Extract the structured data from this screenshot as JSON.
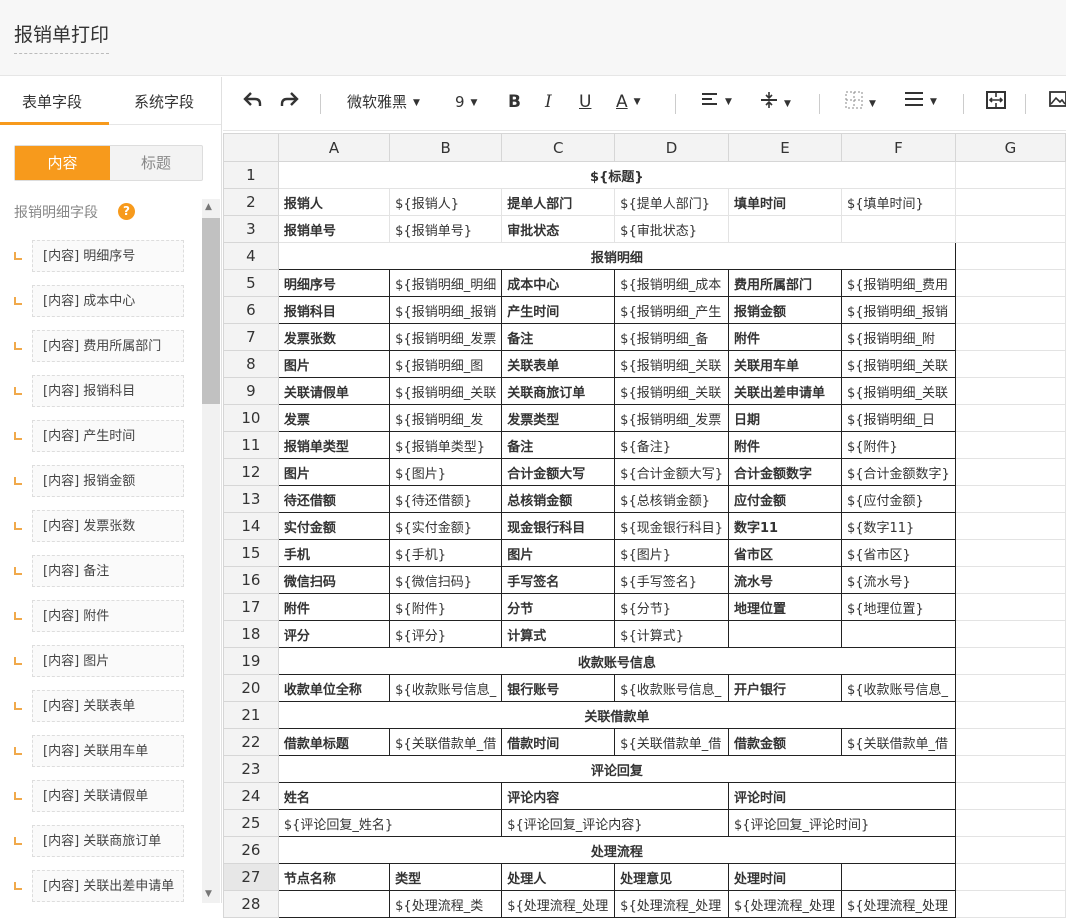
{
  "header": {
    "title": "报销单打印"
  },
  "left_panel": {
    "tabs": [
      "表单字段",
      "系统字段"
    ],
    "segment": [
      "内容",
      "标题"
    ],
    "group_title": "报销明细字段",
    "help_glyph": "?",
    "fields": [
      "[内容] 明细序号",
      "[内容] 成本中心",
      "[内容] 费用所属部门",
      "[内容] 报销科目",
      "[内容] 产生时间",
      "[内容] 报销金额",
      "[内容] 发票张数",
      "[内容] 备注",
      "[内容] 附件",
      "[内容] 图片",
      "[内容] 关联表单",
      "[内容] 关联用车单",
      "[内容] 关联请假单",
      "[内容] 关联商旅订单",
      "[内容] 关联出差申请单"
    ]
  },
  "toolbar": {
    "font_name": "微软雅黑",
    "font_size": "9",
    "bold": "B",
    "italic": "I",
    "underline": "U",
    "font_color": "A"
  },
  "sheet": {
    "col_headers": [
      "A",
      "B",
      "C",
      "D",
      "E",
      "F",
      "G"
    ],
    "row_numbers": [
      "1",
      "2",
      "3",
      "4",
      "5",
      "6",
      "7",
      "8",
      "9",
      "10",
      "11",
      "12",
      "13",
      "14",
      "15",
      "16",
      "17",
      "18",
      "19",
      "20",
      "21",
      "22",
      "23",
      "24",
      "25",
      "26",
      "27",
      "28"
    ],
    "row1": "${标题}",
    "rows2_3": [
      [
        "报销人",
        "${报销人}",
        "提单人部门",
        "${提单人部门}",
        "填单时间",
        "${填单时间}"
      ],
      [
        "报销单号",
        "${报销单号}",
        "审批状态",
        "${审批状态}",
        "",
        ""
      ]
    ],
    "section_detail": "报销明细",
    "rows5_18": [
      [
        "明细序号",
        "${报销明细_明细",
        "成本中心",
        "${报销明细_成本",
        "费用所属部门",
        "${报销明细_费用"
      ],
      [
        "报销科目",
        "${报销明细_报销",
        "产生时间",
        "${报销明细_产生",
        "报销金额",
        "${报销明细_报销"
      ],
      [
        "发票张数",
        "${报销明细_发票",
        "备注",
        "${报销明细_备",
        "附件",
        "${报销明细_附"
      ],
      [
        "图片",
        "${报销明细_图",
        "关联表单",
        "${报销明细_关联",
        "关联用车单",
        "${报销明细_关联"
      ],
      [
        "关联请假单",
        "${报销明细_关联",
        "关联商旅订单",
        "${报销明细_关联",
        "关联出差申请单",
        "${报销明细_关联"
      ],
      [
        "发票",
        "${报销明细_发",
        "发票类型",
        "${报销明细_发票",
        "日期",
        "${报销明细_日"
      ],
      [
        "报销单类型",
        "${报销单类型}",
        "备注",
        "${备注}",
        "附件",
        "${附件}"
      ],
      [
        "图片",
        "${图片}",
        "合计金额大写",
        "${合计金额大写}",
        "合计金额数字",
        "${合计金额数字}"
      ],
      [
        "待还借额",
        "${待还借额}",
        "总核销金额",
        "${总核销金额}",
        "应付金额",
        "${应付金额}"
      ],
      [
        "实付金额",
        "${实付金额}",
        "现金银行科目",
        "${现金银行科目}",
        "数字11",
        "${数字11}"
      ],
      [
        "手机",
        "${手机}",
        "图片",
        "${图片}",
        "省市区",
        "${省市区}"
      ],
      [
        "微信扫码",
        "${微信扫码}",
        "手写签名",
        "${手写签名}",
        "流水号",
        "${流水号}"
      ],
      [
        "附件",
        "${附件}",
        "分节",
        "${分节}",
        "地理位置",
        "${地理位置}"
      ],
      [
        "评分",
        "${评分}",
        "计算式",
        "${计算式}",
        "",
        ""
      ]
    ],
    "section_account": "收款账号信息",
    "row20": [
      "收款单位全称",
      "${收款账号信息_",
      "银行账号",
      "${收款账号信息_",
      "开户银行",
      "${收款账号信息_"
    ],
    "section_loan": "关联借款单",
    "row22": [
      "借款单标题",
      "${关联借款单_借",
      "借款时间",
      "${关联借款单_借",
      "借款金额",
      "${关联借款单_借"
    ],
    "section_comment": "评论回复",
    "row24": [
      "姓名",
      "评论内容",
      "评论时间"
    ],
    "row25": [
      "${评论回复_姓名}",
      "${评论回复_评论内容}",
      "${评论回复_评论时间}"
    ],
    "section_flow": "处理流程",
    "row27": [
      "节点名称",
      "类型",
      "处理人",
      "处理意见",
      "处理时间",
      ""
    ],
    "row28": [
      "",
      "${处理流程_类",
      "${处理流程_处理",
      "${处理流程_处理",
      "${处理流程_处理",
      "${处理流程_处理"
    ]
  }
}
